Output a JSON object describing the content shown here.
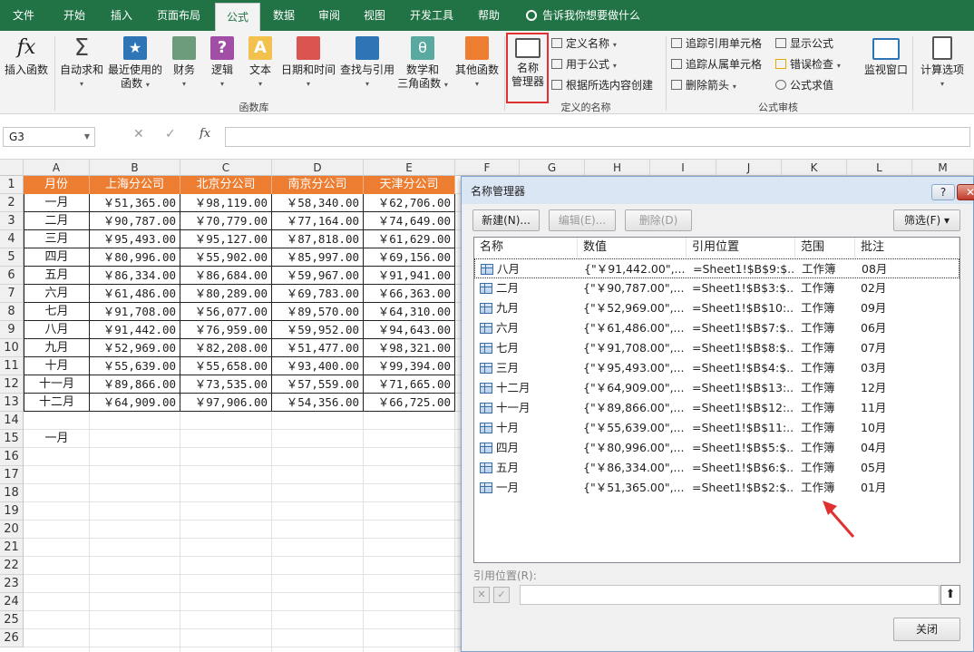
{
  "ribbon": {
    "tabs": [
      "文件",
      "开始",
      "插入",
      "页面布局",
      "公式",
      "数据",
      "审阅",
      "视图",
      "开发工具",
      "帮助"
    ],
    "tell_me": "告诉我你想要做什么",
    "buttons": {
      "insert_function": "插入函数",
      "autosum": "自动求和",
      "recent": [
        "最近使用的",
        "函数"
      ],
      "financial": "财务",
      "logical": "逻辑",
      "text": "文本",
      "datetime": "日期和时间",
      "lookup": "查找与引用",
      "math": [
        "数学和",
        "三角函数"
      ],
      "more": "其他函数",
      "name_manager": [
        "名称",
        "管理器"
      ],
      "define_name": "定义名称",
      "use_in_formula": "用于公式",
      "create_from_selection": "根据所选内容创建",
      "trace_precedents": "追踪引用单元格",
      "trace_dependents": "追踪从属单元格",
      "remove_arrows": "删除箭头",
      "show_formulas": "显示公式",
      "error_checking": "错误检查",
      "evaluate_formula": "公式求值",
      "watch_window": "监视窗口",
      "calc_options": "计算选项"
    },
    "groups": {
      "library": "函数库",
      "defined_names": "定义的名称",
      "auditing": "公式审核"
    }
  },
  "formula_bar": {
    "name_box": "G3",
    "fx": "fx",
    "formula": ""
  },
  "sheet": {
    "columns": [
      "A",
      "B",
      "C",
      "D",
      "E",
      "F",
      "G",
      "H",
      "I",
      "J",
      "K",
      "L",
      "M"
    ],
    "rows": [
      "1",
      "2",
      "3",
      "4",
      "5",
      "6",
      "7",
      "8",
      "9",
      "10",
      "11",
      "12",
      "13",
      "14",
      "15",
      "16",
      "17",
      "18",
      "19",
      "20",
      "21",
      "22",
      "23",
      "24",
      "25",
      "26"
    ],
    "headers": [
      "月份",
      "上海分公司",
      "北京分公司",
      "南京分公司",
      "天津分公司"
    ],
    "data": [
      [
        "一月",
        "￥51,365.00",
        "￥98,119.00",
        "￥58,340.00",
        "￥62,706.00"
      ],
      [
        "二月",
        "￥90,787.00",
        "￥70,779.00",
        "￥77,164.00",
        "￥74,649.00"
      ],
      [
        "三月",
        "￥95,493.00",
        "￥95,127.00",
        "￥87,818.00",
        "￥61,629.00"
      ],
      [
        "四月",
        "￥80,996.00",
        "￥55,902.00",
        "￥85,997.00",
        "￥69,156.00"
      ],
      [
        "五月",
        "￥86,334.00",
        "￥86,684.00",
        "￥59,967.00",
        "￥91,941.00"
      ],
      [
        "六月",
        "￥61,486.00",
        "￥80,289.00",
        "￥69,783.00",
        "￥66,363.00"
      ],
      [
        "七月",
        "￥91,708.00",
        "￥56,077.00",
        "￥89,570.00",
        "￥64,310.00"
      ],
      [
        "八月",
        "￥91,442.00",
        "￥76,959.00",
        "￥59,952.00",
        "￥94,643.00"
      ],
      [
        "九月",
        "￥52,969.00",
        "￥82,208.00",
        "￥51,477.00",
        "￥98,321.00"
      ],
      [
        "十月",
        "￥55,639.00",
        "￥55,658.00",
        "￥93,400.00",
        "￥99,394.00"
      ],
      [
        "十一月",
        "￥89,866.00",
        "￥73,535.00",
        "￥57,559.00",
        "￥71,665.00"
      ],
      [
        "十二月",
        "￥64,909.00",
        "￥97,906.00",
        "￥54,356.00",
        "￥66,725.00"
      ]
    ],
    "a15": "一月"
  },
  "dialog": {
    "title": "名称管理器",
    "help": "?",
    "close_x": "✕",
    "new_btn": "新建(N)...",
    "edit_btn": "编辑(E)...",
    "delete_btn": "删除(D)",
    "filter_btn": "筛选(F) ▾",
    "columns": [
      "名称",
      "数值",
      "引用位置",
      "范围",
      "批注"
    ],
    "rows": [
      [
        "八月",
        "{\"￥91,442.00\",...",
        "=Sheet1!$B$9:$...",
        "工作簿",
        "08月"
      ],
      [
        "二月",
        "{\"￥90,787.00\",...",
        "=Sheet1!$B$3:$...",
        "工作簿",
        "02月"
      ],
      [
        "九月",
        "{\"￥52,969.00\",...",
        "=Sheet1!$B$10:...",
        "工作簿",
        "09月"
      ],
      [
        "六月",
        "{\"￥61,486.00\",...",
        "=Sheet1!$B$7:$...",
        "工作簿",
        "06月"
      ],
      [
        "七月",
        "{\"￥91,708.00\",...",
        "=Sheet1!$B$8:$...",
        "工作簿",
        "07月"
      ],
      [
        "三月",
        "{\"￥95,493.00\",...",
        "=Sheet1!$B$4:$...",
        "工作簿",
        "03月"
      ],
      [
        "十二月",
        "{\"￥64,909.00\",...",
        "=Sheet1!$B$13:...",
        "工作簿",
        "12月"
      ],
      [
        "十一月",
        "{\"￥89,866.00\",...",
        "=Sheet1!$B$12:...",
        "工作簿",
        "11月"
      ],
      [
        "十月",
        "{\"￥55,639.00\",...",
        "=Sheet1!$B$11:...",
        "工作簿",
        "10月"
      ],
      [
        "四月",
        "{\"￥80,996.00\",...",
        "=Sheet1!$B$5:$...",
        "工作簿",
        "04月"
      ],
      [
        "五月",
        "{\"￥86,334.00\",...",
        "=Sheet1!$B$6:$...",
        "工作簿",
        "05月"
      ],
      [
        "一月",
        "{\"￥51,365.00\",...",
        "=Sheet1!$B$2:$...",
        "工作簿",
        "01月"
      ]
    ],
    "refers_to_label": "引用位置(R):",
    "close_btn": "关闭"
  },
  "colors": {
    "ribbon_green": "#217346",
    "header_orange": "#ed7d31",
    "highlight_red": "#e03131"
  }
}
